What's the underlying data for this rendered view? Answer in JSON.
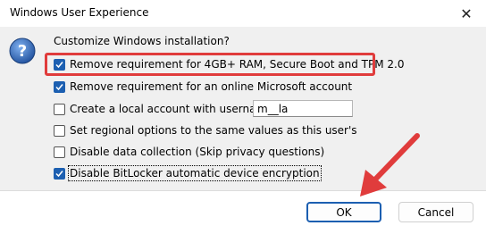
{
  "window": {
    "title": "Windows User Experience",
    "close_glyph": "✕"
  },
  "dialog": {
    "heading": "Customize Windows installation?",
    "options": [
      {
        "label": "Remove requirement for 4GB+ RAM, Secure Boot and TPM 2.0",
        "checked": true
      },
      {
        "label": "Remove requirement for an online Microsoft account",
        "checked": true
      },
      {
        "label": "Create a local account with username:",
        "checked": false
      },
      {
        "label": "Set regional options to the same values as this user's",
        "checked": false
      },
      {
        "label": "Disable data collection (Skip privacy questions)",
        "checked": false
      },
      {
        "label": "Disable BitLocker automatic device encryption",
        "checked": true
      }
    ],
    "username_value": "m__la"
  },
  "buttons": {
    "ok": "OK",
    "cancel": "Cancel"
  },
  "colors": {
    "accent": "#1c5fb1",
    "annotation": "#e03c3c"
  },
  "icons": [
    "question-icon",
    "close-icon",
    "check-icon",
    "annotation-arrow"
  ]
}
